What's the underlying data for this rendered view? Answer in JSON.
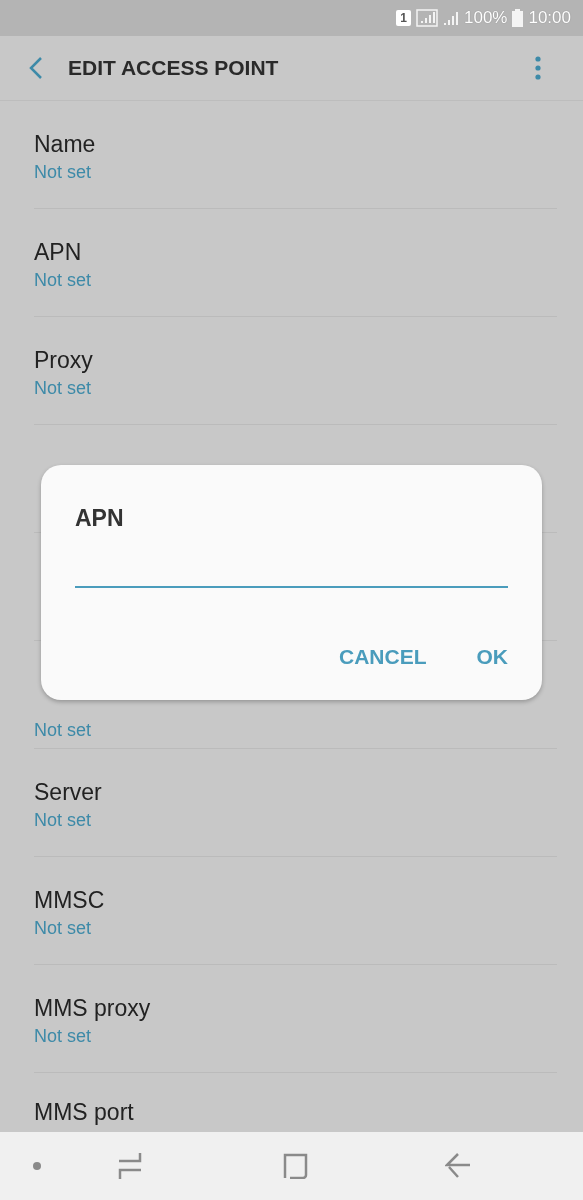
{
  "status_bar": {
    "sim_slot": "1",
    "battery": "100%",
    "time": "10:00"
  },
  "toolbar": {
    "title": "EDIT ACCESS POINT"
  },
  "settings": [
    {
      "kind": "text",
      "title": "Name",
      "value": "Not set"
    },
    {
      "kind": "text",
      "title": "APN",
      "value": "Not set"
    },
    {
      "kind": "text",
      "title": "Proxy",
      "value": "Not set"
    },
    {
      "kind": "covered"
    },
    {
      "kind": "covered"
    },
    {
      "kind": "text",
      "value": "Not set"
    },
    {
      "kind": "text",
      "title": "Server",
      "value": "Not set"
    },
    {
      "kind": "text",
      "title": "MMSC",
      "value": "Not set"
    },
    {
      "kind": "text",
      "title": "MMS proxy",
      "value": "Not set"
    },
    {
      "kind": "text",
      "title": "MMS port"
    }
  ],
  "dialog": {
    "title": "APN",
    "buttons": [
      "CANCEL",
      "OK"
    ]
  }
}
